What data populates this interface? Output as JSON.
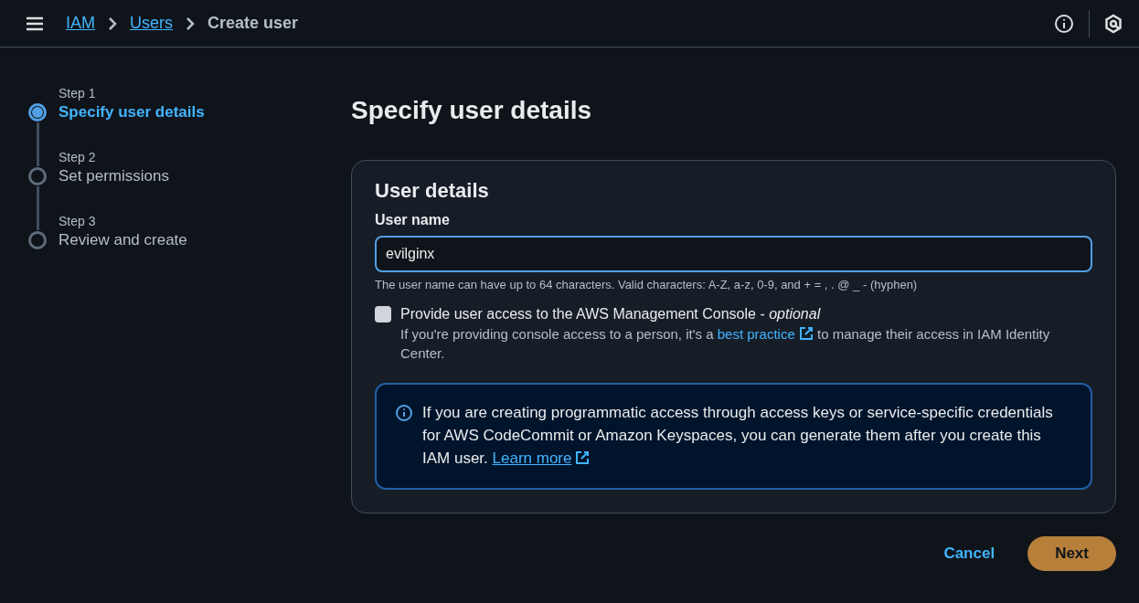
{
  "header": {
    "breadcrumbs": [
      {
        "label": "IAM",
        "link": true
      },
      {
        "label": "Users",
        "link": true
      },
      {
        "label": "Create user",
        "link": false
      }
    ]
  },
  "steps": [
    {
      "step": "Step 1",
      "title": "Specify user details",
      "selected": true
    },
    {
      "step": "Step 2",
      "title": "Set permissions",
      "selected": false
    },
    {
      "step": "Step 3",
      "title": "Review and create",
      "selected": false
    }
  ],
  "page_title": "Specify user details",
  "panel": {
    "title": "User details",
    "user_name": {
      "label": "User name",
      "value": "evilginx",
      "hint": "The user name can have up to 64 characters. Valid characters: A-Z, a-z, 0-9, and + = , . @ _ - (hyphen)"
    },
    "console_access": {
      "label": "Provide user access to the AWS Management Console - *optional*",
      "checked": false,
      "description_before": "If you're providing console access to a person, it's a ",
      "link": "best practice",
      "description_after": " to manage their access in IAM Identity Center."
    },
    "info": {
      "text": "If you are creating programmatic access through access keys or service-specific credentials for AWS CodeCommit or Amazon Keyspaces, you can generate them after you create this IAM user. ",
      "link": "Learn more"
    }
  },
  "actions": {
    "cancel": "Cancel",
    "next": "Next"
  }
}
